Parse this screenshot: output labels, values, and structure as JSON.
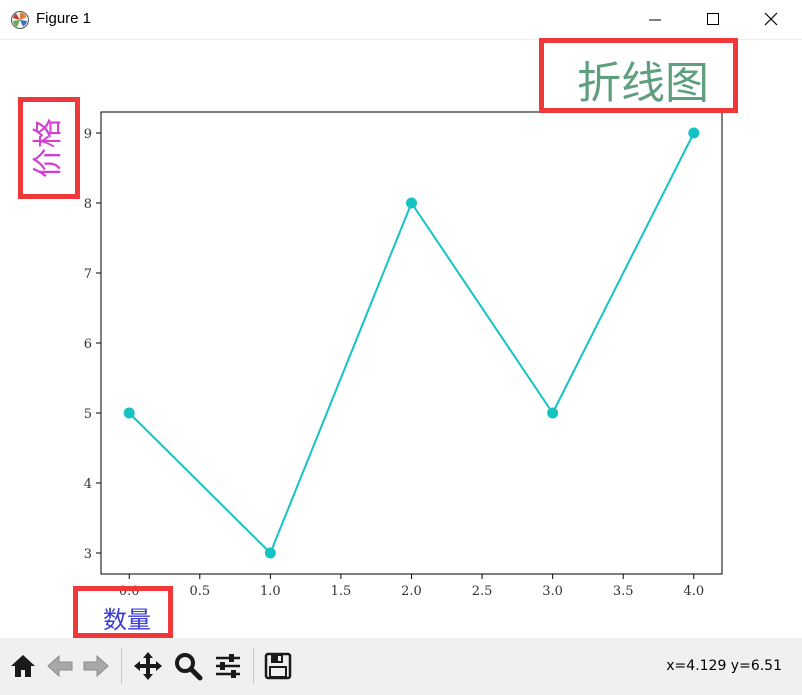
{
  "window": {
    "title": "Figure 1"
  },
  "chart_data": {
    "type": "line",
    "title": "折线图",
    "xlabel": "数量",
    "ylabel": "价格",
    "x": [
      0,
      1,
      2,
      3,
      4
    ],
    "series": [
      {
        "values": [
          5,
          3,
          8,
          5,
          9
        ],
        "color": "#16c3c3"
      }
    ],
    "xlim": [
      -0.2,
      4.2
    ],
    "ylim": [
      2.7,
      9.3
    ],
    "xticks": [
      "0.0",
      "0.5",
      "1.0",
      "1.5",
      "2.0",
      "2.5",
      "3.0",
      "3.5",
      "4.0"
    ],
    "yticks": [
      "3",
      "4",
      "5",
      "6",
      "7",
      "8",
      "9"
    ],
    "grid": false,
    "colors": {
      "title": "#5f9e7f",
      "xlabel": "#3b3bd9",
      "ylabel": "#d23fd2"
    }
  },
  "toolbar": {
    "buttons": [
      "home-icon",
      "back-icon",
      "forward-icon",
      "pan-icon",
      "zoom-icon",
      "configure-subplots-icon",
      "save-icon"
    ]
  },
  "status": {
    "coords": "x=4.129 y=6.51"
  }
}
